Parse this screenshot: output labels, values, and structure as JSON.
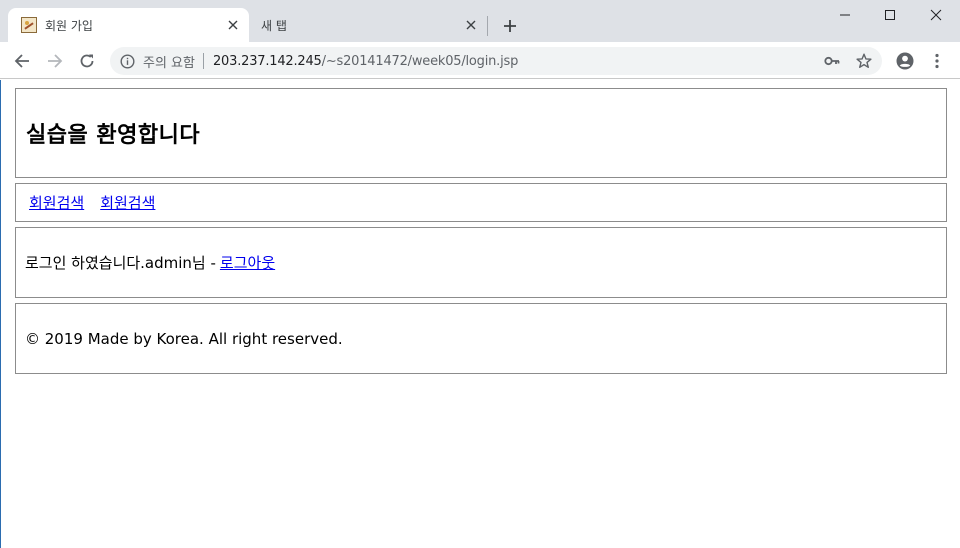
{
  "browser": {
    "tabs": [
      {
        "title": "회원 가입",
        "active": true,
        "favicon": "picture-frame-icon"
      },
      {
        "title": "새 탭",
        "active": false
      }
    ],
    "omnibox": {
      "security_label": "주의 요함",
      "url_host": "203.237.142.245",
      "url_path": "/~s20141472/week05/login.jsp"
    },
    "colors": {
      "titlebar_bg": "#dee1e6",
      "omnibox_bg": "#f1f3f4",
      "link": "#0000ee",
      "box_border": "#8c8c8c"
    }
  },
  "page": {
    "header_title": "실습을 환영합니다",
    "nav_links": [
      "회원검색",
      "회원검색"
    ],
    "main": {
      "message": "로그인 하였습니다.admin님 -",
      "logout_link": "로그아웃"
    },
    "footer_text": "© 2019 Made by Korea. All right reserved."
  }
}
